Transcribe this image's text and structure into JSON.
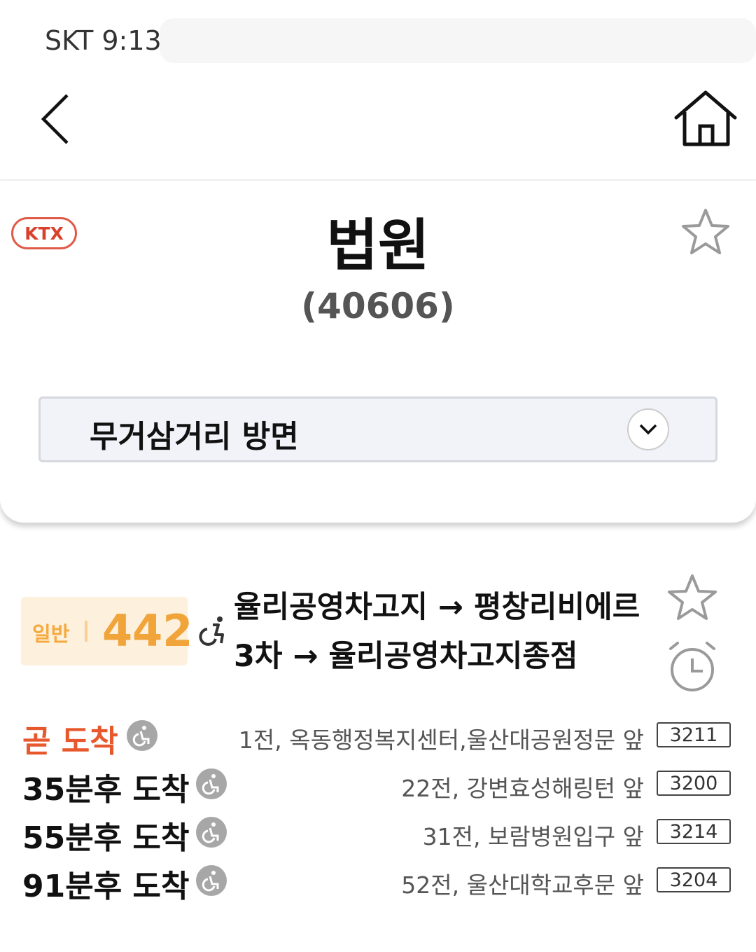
{
  "status_bar": {
    "carrier_time": "SKT 9:13"
  },
  "nav": {
    "back_icon": "chevron-left-icon",
    "home_icon": "home-icon"
  },
  "stop": {
    "badge": "KTX",
    "name": "법원",
    "id": "(40606)",
    "favorite_icon": "star-outline-icon",
    "direction": "무거삼거리 방면"
  },
  "route": {
    "type": "일반",
    "number": "442",
    "description": "율리공영차고지 → 평창리비에르3차 → 율리공영차고지종점",
    "accent": "#f0a43a"
  },
  "arrivals": [
    {
      "time": "곧 도착",
      "stop_info": "1전, 옥동행정복지센터,울산대공원정문 앞",
      "plate": "3211",
      "soon": true
    },
    {
      "time": "35분후 도착",
      "stop_info": "22전, 강변효성해링턴 앞",
      "plate": "3200",
      "soon": false
    },
    {
      "time": "55분후 도착",
      "stop_info": "31전, 보람병원입구 앞",
      "plate": "3214",
      "soon": false
    },
    {
      "time": "91분후 도착",
      "stop_info": "52전, 울산대학교후문 앞",
      "plate": "3204",
      "soon": false
    }
  ],
  "colors": {
    "soon": "#e8582d",
    "ktx": "#d9412d"
  }
}
